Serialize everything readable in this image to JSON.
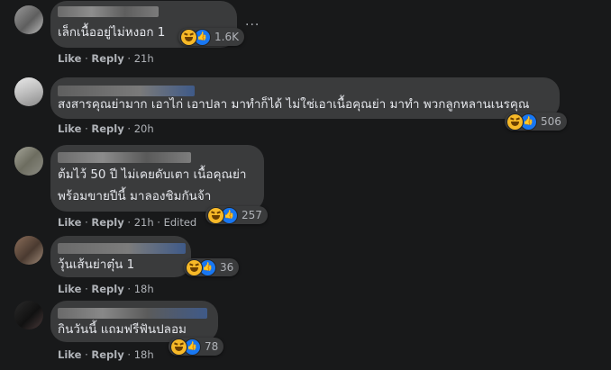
{
  "action_labels": {
    "like": "Like",
    "reply": "Reply",
    "sep": "·",
    "edited": "Edited"
  },
  "more_dots": "···",
  "comments": [
    {
      "lines": [
        "เล็กเนื้ออยู่ไม่หงอก 1"
      ],
      "reaction_count": "1.6K",
      "time": "21h",
      "edited": false
    },
    {
      "lines": [
        "สงสารคุณย่ามาก เอาไก่ เอาปลา มาทำก็ได้ ไม่ใช่เอาเนื้อคุณย่า มาทำ พวกลูกหลานเนรคุณ"
      ],
      "reaction_count": "506",
      "time": "20h",
      "edited": false
    },
    {
      "lines": [
        "ต้มไว้ 50 ปี ไม่เคยดับเตา เนื้อคุณย่า",
        "พร้อมขายปีนี้ มาลองชิมกันจ้า"
      ],
      "reaction_count": "257",
      "time": "21h",
      "edited": true
    },
    {
      "lines": [
        "วุ้นเส้นย่าตุ๋น 1"
      ],
      "reaction_count": "36",
      "time": "18h",
      "edited": false
    },
    {
      "lines": [
        "กินวันนี้ แถมฟรีฟันปลอม"
      ],
      "reaction_count": "78",
      "time": "18h",
      "edited": false
    }
  ],
  "colors": {
    "background": "#18191a",
    "bubble": "#3a3b3c",
    "text": "#e4e6eb",
    "meta": "#b0b3b8",
    "haha": "#f7b928",
    "like": "#1877f2"
  },
  "icons": {
    "reaction_haha": "haha-icon",
    "reaction_like": "like-icon",
    "more": "more-options-icon"
  }
}
